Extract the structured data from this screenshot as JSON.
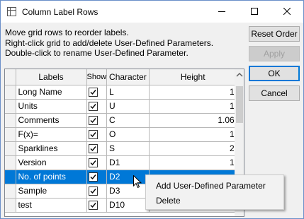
{
  "window": {
    "title": "Column Label Rows"
  },
  "instructions": [
    "Move grid rows to reorder labels.",
    "Right-click grid to add/delete User-Defined Parameters.",
    "Double-click to rename User-Defined Parameter."
  ],
  "buttons": {
    "reset": "Reset Order",
    "apply": "Apply",
    "ok": "OK",
    "cancel": "Cancel"
  },
  "grid": {
    "headers": {
      "labels": "Labels",
      "show": "Show",
      "character": "Character",
      "height": "Height"
    },
    "rows": [
      {
        "label": "Long Name",
        "show": true,
        "character": "L",
        "height": "1"
      },
      {
        "label": "Units",
        "show": true,
        "character": "U",
        "height": "1"
      },
      {
        "label": "Comments",
        "show": true,
        "character": "C",
        "height": "1.06"
      },
      {
        "label": "F(x)=",
        "show": true,
        "character": "O",
        "height": "1"
      },
      {
        "label": "Sparklines",
        "show": true,
        "character": "S",
        "height": "2"
      },
      {
        "label": "Version",
        "show": true,
        "character": "D1",
        "height": "1"
      },
      {
        "label": "No. of points",
        "show": true,
        "character": "D2",
        "height": ""
      },
      {
        "label": "Sample",
        "show": true,
        "character": "D3",
        "height": ""
      },
      {
        "label": "test",
        "show": true,
        "character": "D10",
        "height": "1"
      }
    ],
    "selected_row": 6
  },
  "context_menu": {
    "items": [
      "Add User-Defined Parameter",
      "Delete"
    ]
  },
  "colors": {
    "selection": "#0078d7",
    "ok_border": "#0078d7"
  }
}
